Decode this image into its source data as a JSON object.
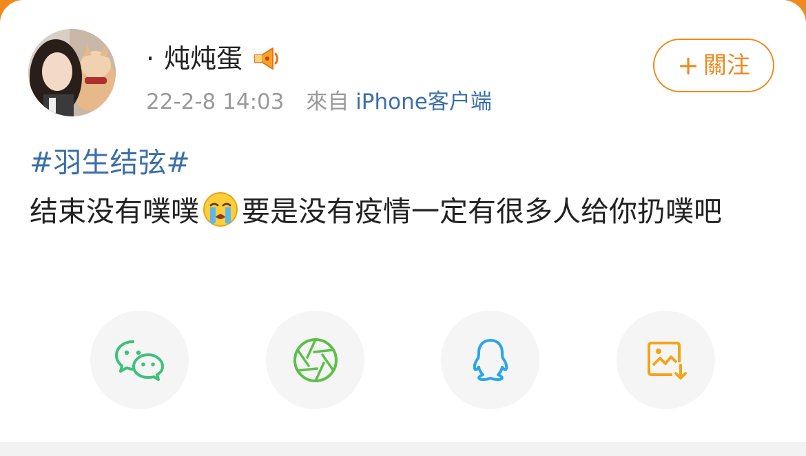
{
  "post": {
    "user": {
      "name": "炖炖蛋",
      "name_prefix": "·",
      "avatar_icon": "avatar-girl-with-cat",
      "badge_icon": "megaphone-icon"
    },
    "meta": {
      "time": "22-2-8 14:03",
      "from_label": "來自",
      "source": "iPhone客户端"
    },
    "follow_label": "關注",
    "follow_plus": "+",
    "hashtag": "#羽生结弦#",
    "content_part1": "结束没有噗噗",
    "content_emoji": "crying-face-emoji",
    "content_part2": "要是没有疫情一定有很多人给你扔噗吧"
  },
  "share": {
    "items": [
      {
        "name": "wechat",
        "icon": "wechat-icon",
        "color": "#3cc27a"
      },
      {
        "name": "moments",
        "icon": "wechat-moments-icon",
        "color": "#5cbf4a"
      },
      {
        "name": "qq",
        "icon": "qq-icon",
        "color": "#2aa6e8"
      },
      {
        "name": "save-image",
        "icon": "save-image-icon",
        "color": "#f5a319"
      }
    ]
  },
  "colors": {
    "accent": "#f0891c",
    "link": "#3b6fa8",
    "text": "#222222",
    "muted": "#9a9a9a",
    "background_top": "#f08a1e"
  }
}
